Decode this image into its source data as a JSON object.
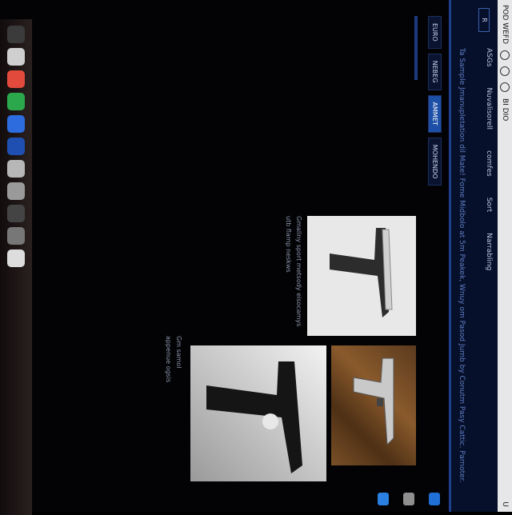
{
  "menubar": {
    "items": [
      "POD WEFD",
      "BI DIO"
    ],
    "clock": "U"
  },
  "header": {
    "logo": "R",
    "nav": [
      "ASGs",
      "Nuvalisorell",
      "comfes",
      "Sort",
      "Narrabling"
    ],
    "tagline": "Ta Sample Jmanupletation dil Mate! Fome Midbolo at 5m Peakek, Wnuy om Pasod Jumb by Conutm Pasy Cattic. Parnoter."
  },
  "tabs": {
    "items": [
      "EURO",
      "NEBEG",
      "AMMET",
      "MOHENDO"
    ],
    "active_index": 2
  },
  "products": [
    {
      "caption": ""
    },
    {
      "caption_1": "Gmaliny sport metsody eisocamys",
      "caption_2": "utb flamp neskws"
    },
    {
      "caption_1": "Gm samol",
      "caption_2": "appenue ogsis"
    }
  ],
  "colors": {
    "nav_bg": "#07102a",
    "accent": "#1d4fa6",
    "menubar_bg": "#e7e7ea"
  }
}
